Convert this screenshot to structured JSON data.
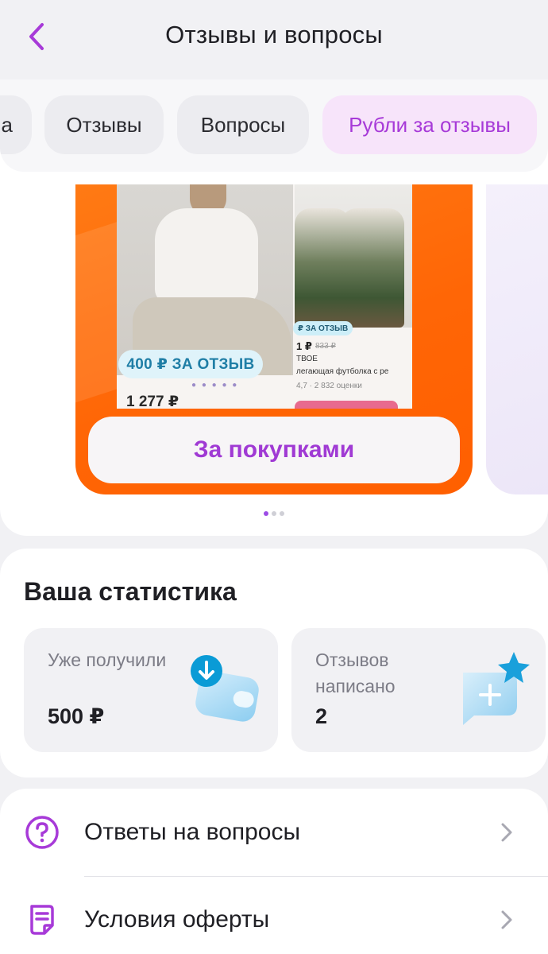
{
  "header": {
    "title": "Отзывы и вопросы",
    "back_icon": "chevron-left-icon"
  },
  "tabs": [
    {
      "label": "а",
      "active": false
    },
    {
      "label": "Отзывы",
      "active": false
    },
    {
      "label": "Вопросы",
      "active": false
    },
    {
      "label": "Рубли за отзывы",
      "active": true
    }
  ],
  "banner": {
    "product_1": {
      "badge": "400 ₽ ЗА ОТЗЫВ",
      "price": "1 277 ₽"
    },
    "product_2": {
      "badge": "₽ ЗА ОТЗЫВ",
      "price": "1 ₽",
      "old_price": "833 ₽",
      "brand": "ТВОЕ",
      "name": "легающая футболка с ре",
      "rating": "4,7 · 2 832 оценки"
    },
    "button_label": "За покупками",
    "pager": {
      "count": 3,
      "active_index": 0
    }
  },
  "stats": {
    "title": "Ваша статистика",
    "received": {
      "label": "Уже получили",
      "value": "500 ₽",
      "icon": "wallet-download-icon"
    },
    "written": {
      "label": "Отзывов написано",
      "value": "2",
      "icon": "chat-bubble-plus-star-icon"
    }
  },
  "menu": [
    {
      "label": "Ответы на вопросы",
      "icon": "question-circle-icon"
    },
    {
      "label": "Условия оферты",
      "icon": "document-icon"
    }
  ],
  "colors": {
    "accent": "#a73ad8",
    "banner_orange": "#ff6606",
    "background": "#f1f1f4",
    "tab_active_bg": "#f7e4fa"
  }
}
